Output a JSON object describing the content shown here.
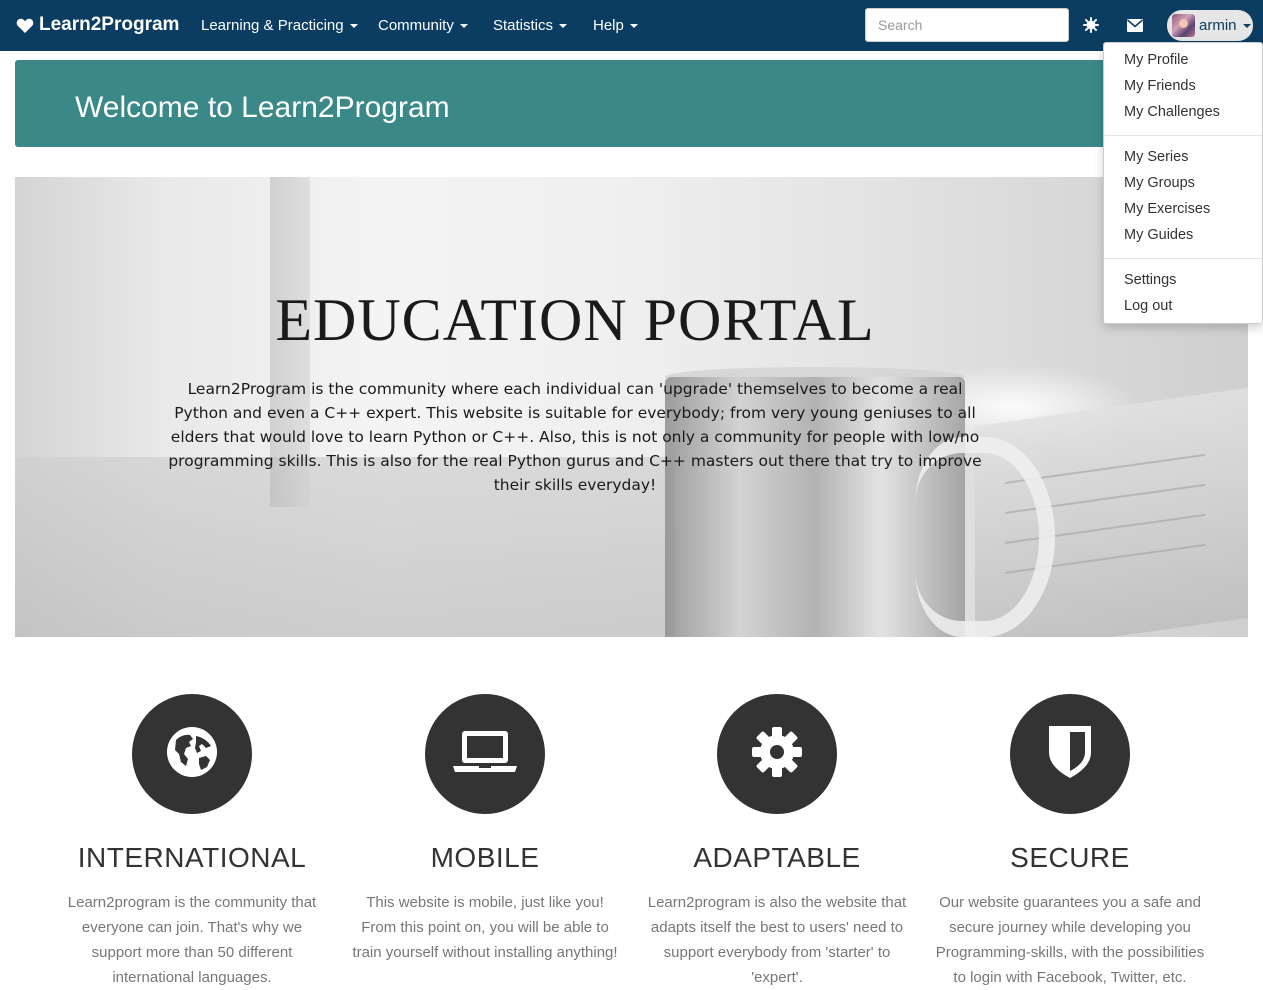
{
  "navbar": {
    "brand": "Learn2Program",
    "menus": [
      {
        "label": "Learning & Practicing"
      },
      {
        "label": "Community"
      },
      {
        "label": "Statistics"
      },
      {
        "label": "Help"
      }
    ],
    "search_placeholder": "Search",
    "user_name": "armin",
    "colors": {
      "background": "#0b3d63"
    }
  },
  "user_menu": {
    "items": [
      "My Profile",
      "My Friends",
      "My Challenges",
      "My Series",
      "My Groups",
      "My Exercises",
      "My Guides",
      "Settings",
      "Log out"
    ]
  },
  "welcome": {
    "title": "Welcome to Learn2Program",
    "color": "#3a8888"
  },
  "hero": {
    "title": "EDUCATION PORTAL",
    "description": "Learn2Program is the community where each individual can 'upgrade' themselves to become a real Python and even a C++ expert. This website is suitable for everybody; from very young geniuses to all elders that would love to learn Python or C++. Also, this is not only a community for people with low/no programming skills. This is also for the real Python gurus and C++ masters out there that try to improve their skills everyday!"
  },
  "features": [
    {
      "icon": "globe-icon",
      "title": "INTERNATIONAL",
      "text": "Learn2program is the community that everyone can join. That's why we support more than 50 different international languages."
    },
    {
      "icon": "laptop-icon",
      "title": "MOBILE",
      "text": "This website is mobile, just like you! From this point on, you will be able to train yourself without installing anything!"
    },
    {
      "icon": "gear-icon",
      "title": "ADAPTABLE",
      "text": "Learn2program is also the website that adapts itself the best to users' need to support everybody from 'starter' to 'expert'."
    },
    {
      "icon": "shield-icon",
      "title": "SECURE",
      "text": "Our website guarantees you a safe and secure journey while developing you Programming-skills, with the possibilities to login with Facebook, Twitter, etc."
    }
  ]
}
